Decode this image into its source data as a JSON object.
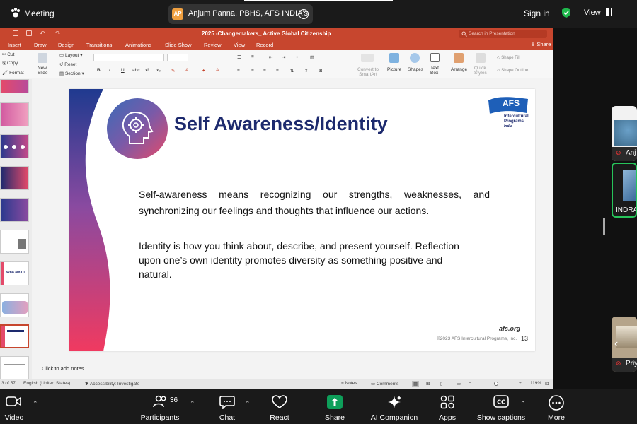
{
  "zoom": {
    "meeting_label": "Meeting",
    "speaker": {
      "initials": "AP",
      "name": "Anjum Panna, PBHS, AFS INDIA's"
    },
    "sign_in": "Sign in",
    "view": "View",
    "participants_count": "36",
    "toolbar": [
      {
        "key": "video",
        "label": "Video"
      },
      {
        "key": "participants",
        "label": "Participants"
      },
      {
        "key": "chat",
        "label": "Chat"
      },
      {
        "key": "react",
        "label": "React"
      },
      {
        "key": "share",
        "label": "Share"
      },
      {
        "key": "ai",
        "label": "AI Companion"
      },
      {
        "key": "apps",
        "label": "Apps"
      },
      {
        "key": "captions",
        "label": "Show captions"
      },
      {
        "key": "more",
        "label": "More"
      }
    ],
    "tiles": [
      {
        "name": "Anj"
      },
      {
        "name": "INDRA"
      },
      {
        "name": "Priy"
      }
    ],
    "colors": {
      "share": "#0e9f5a",
      "shield": "#1fb84c"
    }
  },
  "ppt": {
    "title": "2025 -Changemakers_ Active Global Citizenship",
    "search_placeholder": "Search in Presentation",
    "tabs": [
      "Insert",
      "Draw",
      "Design",
      "Transitions",
      "Animations",
      "Slide Show",
      "Review",
      "View",
      "Record"
    ],
    "share": "Share",
    "ribbon": {
      "cut": "Cut",
      "copy": "Copy",
      "format": "Format",
      "new_slide": "New Slide",
      "layout": "Layout",
      "reset": "Reset",
      "section": "Section",
      "convert": "Convert to SmartArt",
      "picture": "Picture",
      "shapes": "Shapes",
      "text_box": "Text Box",
      "arrange": "Arrange",
      "quick_styles": "Quick Styles",
      "shape_fill": "Shape Fill",
      "shape_outline": "Shape Outline"
    },
    "slide": {
      "title": "Self Awareness/Identity",
      "p1": "Self-awareness means recognizing our strengths, weaknesses, and synchronizing our feelings and thoughts that influence our actions.",
      "p2": "Identity is how you think about, describe, and present yourself. Reflection upon one’s own identity promotes diversity as something positive and natural.",
      "logo_main": "AFS",
      "logo_sub1": "Intercultural",
      "logo_sub2": "Programs",
      "logo_sub3": "India",
      "afs_org": "afs.org",
      "copyright": "©2023 AFS Intercultural Programs, Inc.",
      "page": "13"
    },
    "thumb_texts": [
      "Who am I ?"
    ],
    "notes_placeholder": "Click to add notes",
    "status": {
      "slide_of": "3 of 57",
      "language": "English (United States)",
      "accessibility": "Accessibility: Investigate",
      "notes": "Notes",
      "comments": "Comments",
      "zoom": "119%"
    },
    "colors": {
      "ribbon": "#c7462e",
      "title_navy": "#1d2a6e"
    }
  }
}
